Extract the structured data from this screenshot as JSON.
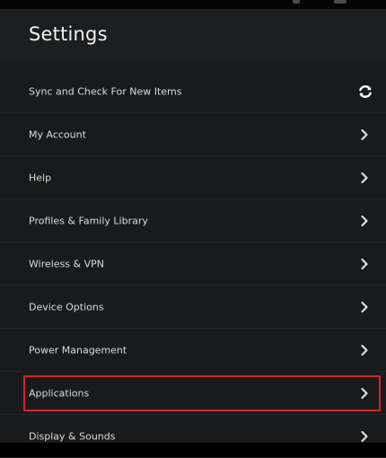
{
  "header": {
    "title": "Settings"
  },
  "settings": {
    "items": [
      {
        "label": "Sync and Check For New Items",
        "icon": "sync-icon"
      },
      {
        "label": "My Account",
        "icon": "chevron-right-icon"
      },
      {
        "label": "Help",
        "icon": "chevron-right-icon"
      },
      {
        "label": "Profiles & Family Library",
        "icon": "chevron-right-icon"
      },
      {
        "label": "Wireless & VPN",
        "icon": "chevron-right-icon"
      },
      {
        "label": "Device Options",
        "icon": "chevron-right-icon"
      },
      {
        "label": "Power Management",
        "icon": "chevron-right-icon"
      },
      {
        "label": "Applications",
        "icon": "chevron-right-icon",
        "highlighted": true
      },
      {
        "label": "Display & Sounds",
        "icon": "chevron-right-icon"
      }
    ]
  },
  "colors": {
    "background": "#181a1c",
    "text": "#dcdcdc",
    "highlight": "#d9202c"
  }
}
